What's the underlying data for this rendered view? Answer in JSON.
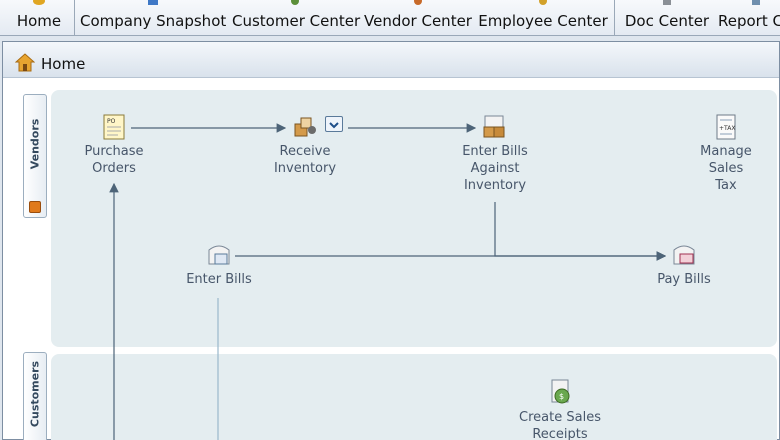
{
  "toolbar": {
    "items": [
      {
        "label": "Home",
        "icon": "home-icon"
      },
      {
        "label": "Company Snapshot",
        "icon": "snapshot-icon"
      },
      {
        "label": "Customer Center",
        "icon": "customer-center-icon"
      },
      {
        "label": "Vendor Center",
        "icon": "vendor-center-icon"
      },
      {
        "label": "Employee Center",
        "icon": "employee-center-icon"
      },
      {
        "label": "Doc Center",
        "icon": "doc-center-icon"
      },
      {
        "label": "Report C",
        "icon": "report-center-icon"
      }
    ]
  },
  "window": {
    "title": "Home"
  },
  "vendors": {
    "tab_label": "Vendors",
    "nodes": {
      "purchase_orders": {
        "line1": "Purchase",
        "line2": "Orders"
      },
      "receive_inventory": {
        "line1": "Receive",
        "line2": "Inventory"
      },
      "enter_bills_inventory": {
        "line1": "Enter Bills",
        "line2": "Against",
        "line3": "Inventory"
      },
      "manage_sales_tax": {
        "line1": "Manage",
        "line2": "Sales",
        "line3": "Tax"
      },
      "enter_bills": {
        "line1": "Enter Bills"
      },
      "pay_bills": {
        "line1": "Pay Bills"
      }
    }
  },
  "customers": {
    "tab_label": "Customers",
    "nodes": {
      "create_sales_receipts": {
        "line1": "Create Sales",
        "line2": "Receipts"
      }
    }
  },
  "colors": {
    "panel": "#e4edf0",
    "flow_line": "#4d6478",
    "label": "#47566a"
  }
}
